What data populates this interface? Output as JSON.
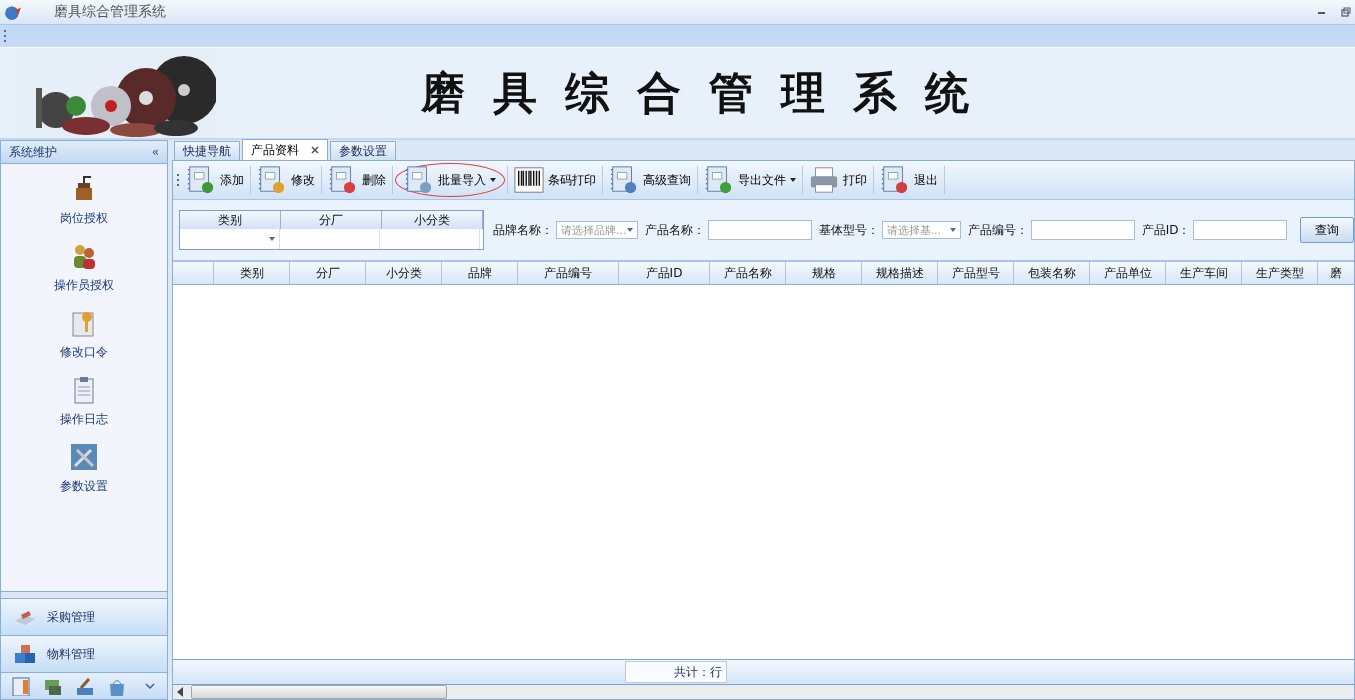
{
  "window": {
    "title": "磨具综合管理系统"
  },
  "banner": {
    "title": "磨具综合管理系统"
  },
  "sidebar": {
    "title": "系统维护",
    "collapse": "«",
    "items": [
      {
        "label": "岗位授权",
        "kind": "grinder"
      },
      {
        "label": "操作员授权",
        "kind": "users"
      },
      {
        "label": "修改口令",
        "kind": "key"
      },
      {
        "label": "操作日志",
        "kind": "log"
      },
      {
        "label": "参数设置",
        "kind": "tools"
      }
    ],
    "groups": [
      {
        "label": "采购管理",
        "kind": "purchase"
      },
      {
        "label": "物料管理",
        "kind": "material"
      }
    ],
    "shortcuts": [
      {
        "kind": "list"
      },
      {
        "kind": "money"
      },
      {
        "kind": "hammer"
      },
      {
        "kind": "calc"
      }
    ]
  },
  "tabs": [
    {
      "label": "快捷导航",
      "selected": false,
      "closable": false
    },
    {
      "label": "产品资料",
      "selected": true,
      "closable": true
    },
    {
      "label": "参数设置",
      "selected": false,
      "closable": false
    }
  ],
  "toolbar": [
    {
      "label": "添加",
      "kind": "add",
      "dropdown": false,
      "circled": false
    },
    {
      "label": "修改",
      "kind": "edit",
      "dropdown": false,
      "circled": false
    },
    {
      "label": "删除",
      "kind": "delete",
      "dropdown": false,
      "circled": false
    },
    {
      "label": "批量导入",
      "kind": "import",
      "dropdown": true,
      "circled": true
    },
    {
      "label": "条码打印",
      "kind": "barcode",
      "dropdown": false,
      "circled": false
    },
    {
      "label": "高级查询",
      "kind": "search",
      "dropdown": false,
      "circled": false
    },
    {
      "label": "导出文件",
      "kind": "export",
      "dropdown": true,
      "circled": false
    },
    {
      "label": "打印",
      "kind": "print",
      "dropdown": false,
      "circled": false
    },
    {
      "label": "退出",
      "kind": "exit",
      "dropdown": false,
      "circled": false
    }
  ],
  "category_filter": {
    "columns": [
      "类别",
      "分厂",
      "小分类"
    ]
  },
  "filters": [
    {
      "label": "品牌名称：",
      "kind": "combo",
      "placeholder": "请选择品牌..."
    },
    {
      "label": "产品名称：",
      "kind": "text"
    },
    {
      "label": "基体型号：",
      "kind": "combo",
      "placeholder": "请选择基..."
    },
    {
      "label": "产品编号：",
      "kind": "text"
    },
    {
      "label": "产品ID：",
      "kind": "text"
    }
  ],
  "query_button": "查询",
  "table": {
    "columns": [
      "类别",
      "分厂",
      "小分类",
      "品牌",
      "产品编号",
      "产品ID",
      "产品名称",
      "规格",
      "规格描述",
      "产品型号",
      "包装名称",
      "产品单位",
      "生产车间",
      "生产类型",
      "磨"
    ]
  },
  "status_bar": {
    "total": "共计：行"
  }
}
